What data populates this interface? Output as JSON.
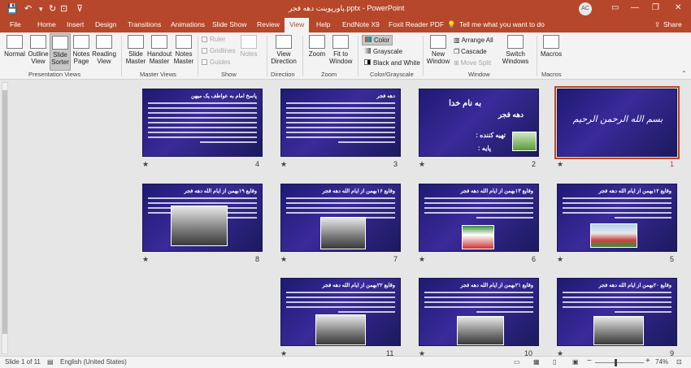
{
  "titlebar": {
    "title": "پاورپوینت دهه فجر.pptx  -  PowerPoint",
    "user_initials": "AC",
    "qat_save": "💾",
    "qat_undo": "↶",
    "qat_redo": "↻",
    "qat_customize": "⊽",
    "btn_minimize": "—",
    "btn_restore": "❐",
    "btn_close": "✕",
    "ribbon_display_icon": "▭"
  },
  "tabs": [
    "File",
    "Home",
    "Insert",
    "Design",
    "Transitions",
    "Animations",
    "Slide Show",
    "Review",
    "View",
    "Help",
    "EndNote X9",
    "Foxit Reader PDF"
  ],
  "active_tab": "View",
  "tell_me": "Tell me what you want to do",
  "share": "Share",
  "ribbon": {
    "presentation_views": {
      "label": "Presentation Views",
      "normal": "Normal",
      "outline": "Outline View",
      "sorter": "Slide Sorter",
      "notes": "Notes Page",
      "reading": "Reading View"
    },
    "master_views": {
      "label": "Master Views",
      "slide_master": "Slide Master",
      "handout_master": "Handout Master",
      "notes_master": "Notes Master"
    },
    "show": {
      "label": "Show",
      "ruler": "Ruler",
      "gridlines": "Gridlines",
      "guides": "Guides",
      "notes": "Notes"
    },
    "direction": {
      "label": "Direction",
      "view_direction": "View Direction"
    },
    "zoom": {
      "label": "Zoom",
      "zoom": "Zoom",
      "fit": "Fit to Window"
    },
    "color": {
      "label": "Color/Grayscale",
      "color": "Color",
      "grayscale": "Grayscale",
      "bw": "Black and White"
    },
    "window": {
      "label": "Window",
      "new_window": "New Window",
      "arrange_all": "Arrange All",
      "cascade": "Cascade",
      "move_split": "Move Split",
      "switch": "Switch Windows"
    },
    "macros": {
      "label": "Macros",
      "macros": "Macros"
    }
  },
  "slides": [
    {
      "num": "1",
      "title": "بسم الله الرحمن الرحیم",
      "selected": true
    },
    {
      "num": "2",
      "title": "دهه فجر"
    },
    {
      "num": "3",
      "title": "دهه فجر"
    },
    {
      "num": "4",
      "title": "پاسخ امام به عواطف یک میهن"
    },
    {
      "num": "5",
      "title": "وقایع ۱۲بهمن از ایام الله دهه فجر"
    },
    {
      "num": "6",
      "title": "وقایع ۱۳بهمن از ایام الله دهه فجر"
    },
    {
      "num": "7",
      "title": "وقایع ۱۶بهمن از ایام الله دهه فجر"
    },
    {
      "num": "8",
      "title": "وقایع ۱۹بهمن از ایام الله دهه فجر"
    },
    {
      "num": "9",
      "title": "وقایع ۲۰بهمن از ایام الله دهه فجر"
    },
    {
      "num": "10",
      "title": "وقایع ۲۱بهمن از ایام الله دهه فجر"
    },
    {
      "num": "11",
      "title": "وقایع ۲۲بهمن از ایام الله دهه فجر"
    }
  ],
  "slide2_lines": [
    "به نام خدا",
    "دهه فجر",
    "تهیه کننده :",
    "پایه :"
  ],
  "status": {
    "slide": "Slide 1 of 11",
    "language": "English (United States)",
    "zoom": "74%",
    "zoom_minus": "−",
    "zoom_plus": "+"
  }
}
